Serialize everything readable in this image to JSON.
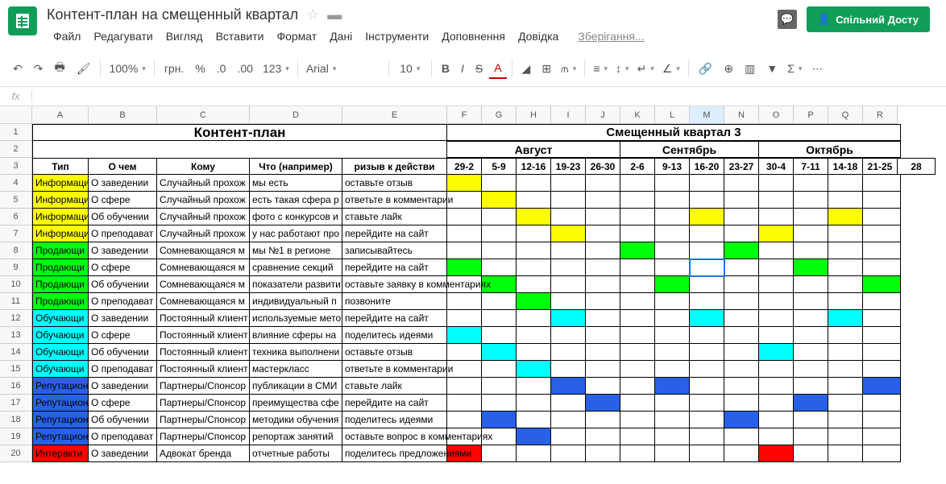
{
  "doc": {
    "title": "Контент-план на смещенный квартал",
    "saving": "Зберігання..."
  },
  "menu": [
    "Файл",
    "Редагувати",
    "Вигляд",
    "Вставити",
    "Формат",
    "Дані",
    "Інструменти",
    "Доповнення",
    "Довідка"
  ],
  "share": "Спільний Досту",
  "toolbar": {
    "zoom": "100%",
    "currency": "грн.",
    "pct": "%",
    "dec0": ".0",
    "dec00": ".00",
    "num": "123",
    "font": "Arial",
    "size": "10",
    "bold": "B",
    "italic": "I",
    "strike": "S",
    "underline": "A"
  },
  "fx": "fx",
  "cols": [
    "A",
    "B",
    "C",
    "D",
    "E",
    "F",
    "G",
    "H",
    "I",
    "J",
    "K",
    "L",
    "M",
    "N",
    "O",
    "P",
    "Q",
    "R"
  ],
  "selectedCol": "M",
  "rowNums": [
    1,
    2,
    3,
    4,
    5,
    6,
    7,
    8,
    9,
    10,
    11,
    12,
    13,
    14,
    15,
    16,
    17,
    18,
    19,
    20
  ],
  "title1": "Контент-план",
  "title2": "Смещенный квартал 3",
  "months": [
    "Август",
    "Сентябрь",
    "Октябрь"
  ],
  "headers3": [
    "Тип",
    "О чем",
    "Кому",
    "Что (например)",
    "ризыв к действи",
    "29-2",
    "5-9",
    "12-16",
    "19-23",
    "26-30",
    "2-6",
    "9-13",
    "16-20",
    "23-27",
    "30-4",
    "7-11",
    "14-18",
    "21-25",
    "28"
  ],
  "rows": [
    {
      "type": "Информаци",
      "c": "c-yellow",
      "about": "О заведении",
      "who": "Случайный прохож",
      "what": "мы есть",
      "cta": "оставьте отзыв",
      "fill": [
        0,
        14
      ]
    },
    {
      "type": "Информаци",
      "c": "c-yellow",
      "about": "О сфере",
      "who": "Случайный прохож",
      "what": "есть такая сфера р",
      "cta": "ответьте в комментарии",
      "fill": [
        1
      ]
    },
    {
      "type": "Информаци",
      "c": "c-yellow",
      "about": "Об обучении",
      "who": "Случайный прохож",
      "what": "фото с конкурсов и",
      "cta": "ставьте лайк",
      "fill": [
        2,
        7,
        11,
        16
      ]
    },
    {
      "type": "Информаци",
      "c": "c-yellow",
      "about": "О преподават",
      "who": "Случайный прохож",
      "what": "у нас работают про",
      "cta": "перейдите на сайт",
      "fill": [
        3,
        9
      ]
    },
    {
      "type": "Продающи",
      "c": "c-green",
      "about": "О заведении",
      "who": "Сомневающаяся м",
      "what": "мы №1 в регионе",
      "cta": "записывайтесь",
      "fill": [
        5,
        8,
        13
      ]
    },
    {
      "type": "Продающи",
      "c": "c-green",
      "about": "О сфере",
      "who": "Сомневающаяся м",
      "what": "сравнение секций",
      "cta": "перейдите на сайт",
      "fill": [
        0,
        10
      ]
    },
    {
      "type": "Продающи",
      "c": "c-green",
      "about": "Об обучении",
      "who": "Сомневающаяся м",
      "what": "показатели развити",
      "cta": "оставьте заявку в комментариях",
      "fill": [
        1,
        6,
        12,
        15
      ]
    },
    {
      "type": "Продающи",
      "c": "c-green",
      "about": "О преподават",
      "who": "Сомневающаяся м",
      "what": "индивидуальный п",
      "cta": "позвоните",
      "fill": [
        2
      ]
    },
    {
      "type": "Обучающи",
      "c": "c-cyan",
      "about": "О заведении",
      "who": "Постоянный клиент",
      "what": "используемые мето",
      "cta": "перейдите на сайт",
      "fill": [
        3,
        7,
        11
      ]
    },
    {
      "type": "Обучающи",
      "c": "c-cyan",
      "about": "О сфере",
      "who": "Постоянный клиент",
      "what": "влияние сферы на",
      "cta": "поделитесь идеями",
      "fill": [
        0,
        14
      ]
    },
    {
      "type": "Обучающи",
      "c": "c-cyan",
      "about": "Об обучении",
      "who": "Постоянный клиент",
      "what": "техника выполнени",
      "cta": "оставьте отзыв",
      "fill": [
        1,
        9,
        16
      ]
    },
    {
      "type": "Обучающи",
      "c": "c-cyan",
      "about": "О преподават",
      "who": "Постоянный клиент",
      "what": "мастеркласс",
      "cta": "ответьте в комментарии",
      "fill": [
        2
      ]
    },
    {
      "type": "Репутацион",
      "c": "c-blue",
      "about": "О заведении",
      "who": "Партнеры/Спонсор",
      "what": "публикации в СМИ",
      "cta": "ставьте лайк",
      "fill": [
        3,
        6,
        12,
        15
      ]
    },
    {
      "type": "Репутацион",
      "c": "c-blue",
      "about": "О сфере",
      "who": "Партнеры/Спонсор",
      "what": "преимущества сфе",
      "cta": "перейдите на сайт",
      "fill": [
        4,
        10
      ]
    },
    {
      "type": "Репутацион",
      "c": "c-blue",
      "about": "Об обучении",
      "who": "Партнеры/Спонсор",
      "what": "методики обучения",
      "cta": "поделитесь идеями",
      "fill": [
        1,
        8,
        13
      ]
    },
    {
      "type": "Репутацион",
      "c": "c-blue",
      "about": "О преподават",
      "who": "Партнеры/Спонсор",
      "what": "репортаж занятий",
      "cta": "оставьте вопрос в комментариях",
      "fill": [
        2
      ]
    },
    {
      "type": "Интеракти",
      "c": "c-red",
      "about": "О заведении",
      "who": "Адвокат бренда",
      "what": "отчетные работы",
      "cta": "поделитесь предложениями",
      "fill": [
        0,
        9,
        16
      ]
    }
  ]
}
